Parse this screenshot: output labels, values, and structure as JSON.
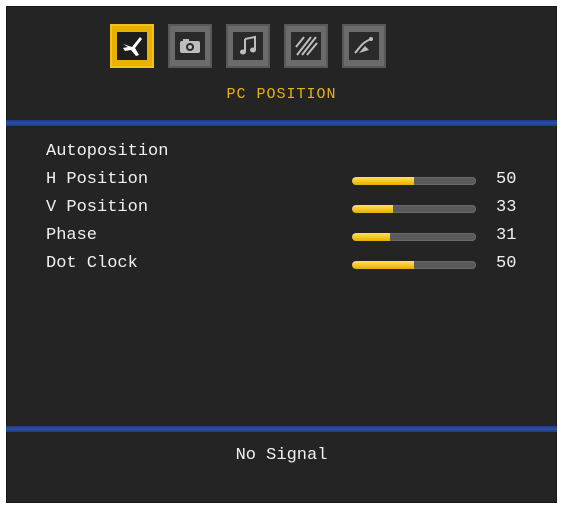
{
  "menu": {
    "title": "PC POSITION",
    "icons": [
      {
        "name": "pc-position-icon",
        "active": true
      },
      {
        "name": "picture-icon",
        "active": false
      },
      {
        "name": "sound-icon",
        "active": false
      },
      {
        "name": "settings-icon",
        "active": false
      },
      {
        "name": "install-icon",
        "active": false
      }
    ]
  },
  "items": [
    {
      "label": "Autoposition"
    },
    {
      "label": "H Position",
      "value": "50"
    },
    {
      "label": "V Position",
      "value": "33"
    },
    {
      "label": "Phase",
      "value": "31"
    },
    {
      "label": "Dot Clock",
      "value": "50"
    }
  ],
  "footer": {
    "status": "No Signal"
  },
  "colors": {
    "accent": "#e6b414",
    "band": "#2b4ea5",
    "background": "#242424"
  }
}
